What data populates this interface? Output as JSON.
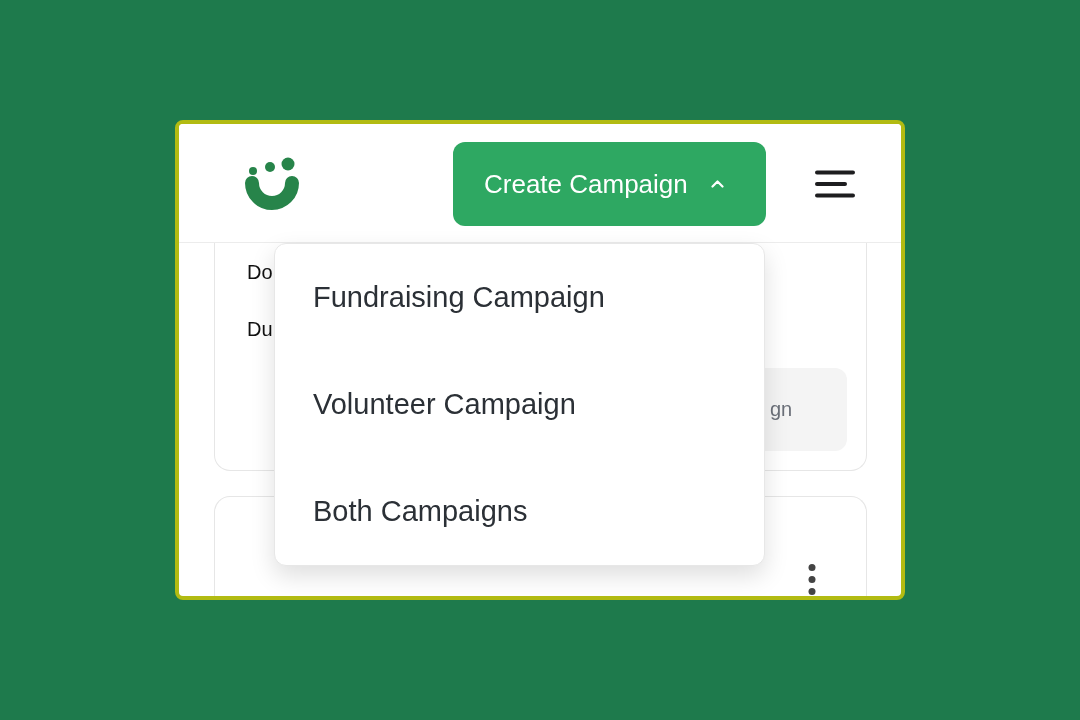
{
  "header": {
    "create_button": {
      "label": "Create Campaign",
      "expanded": true
    }
  },
  "create_menu": {
    "items": [
      {
        "label": "Fundraising Campaign"
      },
      {
        "label": "Volunteer Campaign"
      },
      {
        "label": "Both Campaigns"
      }
    ]
  },
  "cards": [
    {
      "kind": "details",
      "lines": [
        "Do",
        "Du"
      ],
      "action_label": "gn"
    },
    {
      "kind": "options"
    }
  ]
}
